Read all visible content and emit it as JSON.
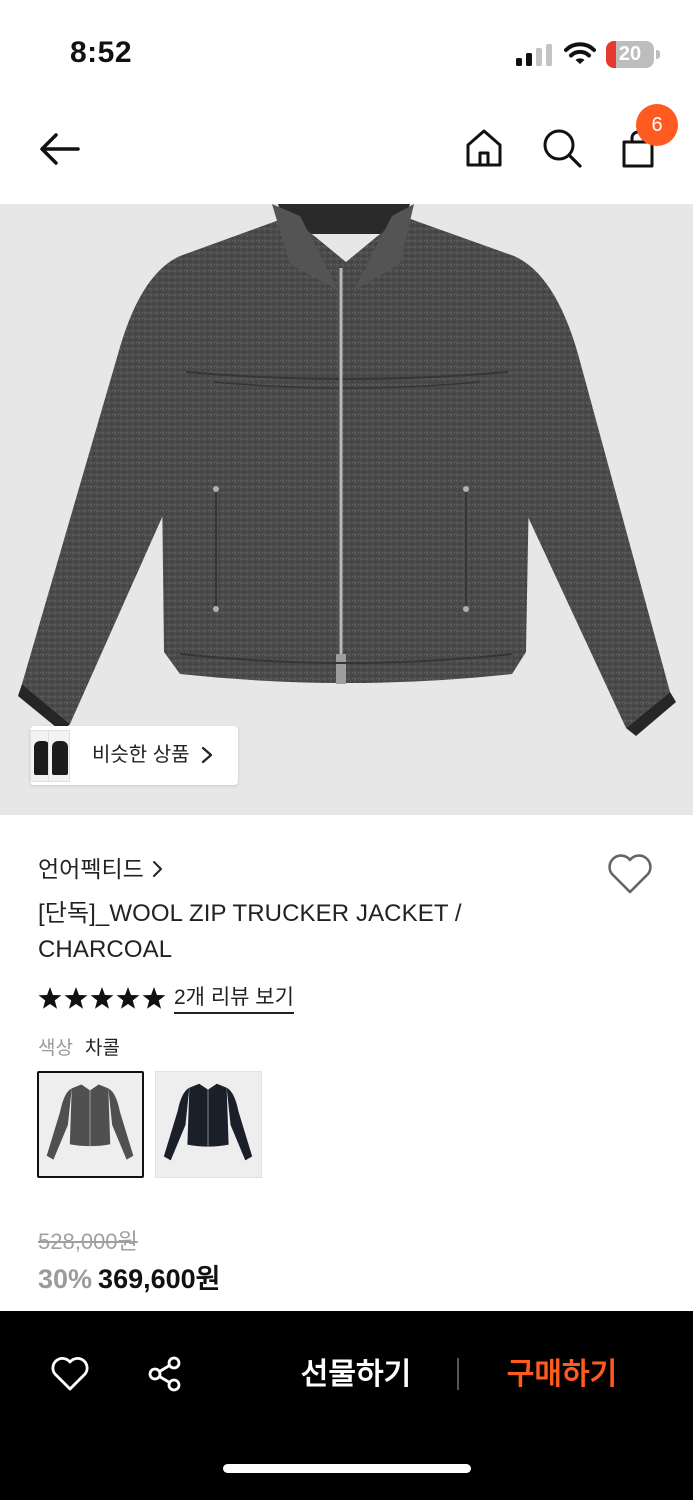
{
  "status_bar": {
    "time": "8:52",
    "battery_level": "20",
    "battery_fraction": 0.2,
    "battery_color": "#e5382e"
  },
  "nav": {
    "back_icon": "arrow-left-icon",
    "home_icon": "home-icon",
    "search_icon": "search-icon",
    "cart_icon": "shopping-bag-icon",
    "cart_count": "6",
    "badge_color": "#ff5a1f"
  },
  "gallery": {
    "similar_label": "비슷한 상품"
  },
  "product": {
    "brand": "언어펙티드",
    "name": "[단독]_WOOL ZIP TRUCKER JACKET / CHARCOAL",
    "rating_stars": 5,
    "review_link": "2개 리뷰 보기",
    "color_label": "색상",
    "color_value": "차콜",
    "swatches": [
      "charcoal",
      "navy"
    ],
    "original_price": "528,000원",
    "discount": "30%",
    "sale_price": "369,600원"
  },
  "bottom_bar": {
    "gift_label": "선물하기",
    "buy_label": "구매하기",
    "accent_color": "#ff5a1f"
  }
}
